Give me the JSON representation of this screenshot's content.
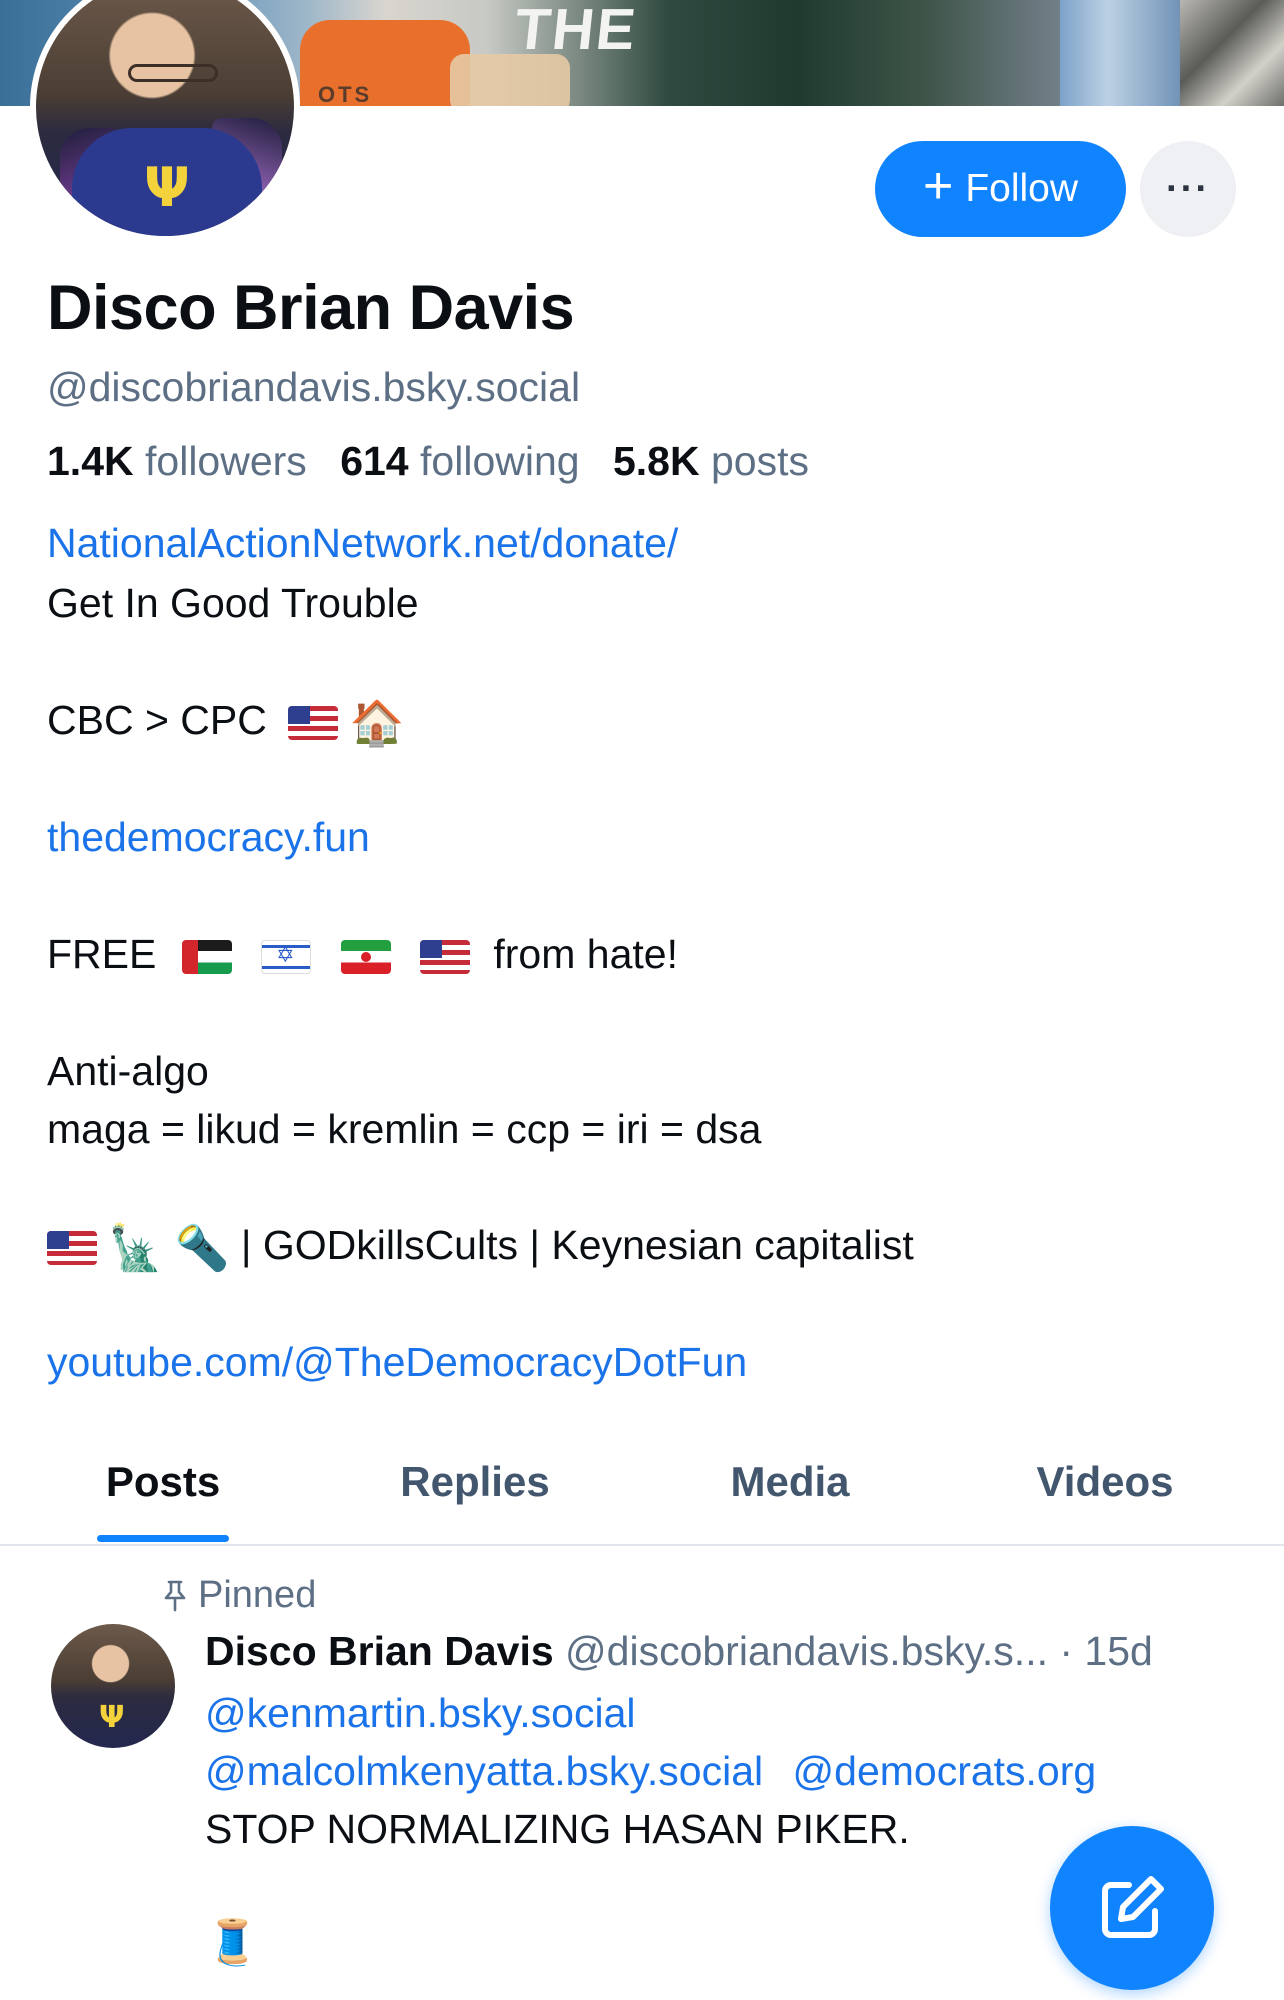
{
  "profile": {
    "name": "Disco Brian Davis",
    "handle": "@discobriandavis.bsky.social",
    "follow_label": "Follow",
    "more_label": "···",
    "stats": {
      "followers_count": "1.4K",
      "followers_label": "followers",
      "following_count": "614",
      "following_label": "following",
      "posts_count": "5.8K",
      "posts_label": "posts"
    }
  },
  "bio": {
    "link1": "NationalActionNetwork.net/donate/",
    "line1": "Get In Good Trouble",
    "line2": "CBC > CPC",
    "link2": "thedemocracy.fun",
    "free_text": "FREE",
    "from_hate": "from hate!",
    "line4": "Anti-algo",
    "line5": "maga = likud = kremlin = ccp = iri = dsa",
    "line6_rest": "| GODkillsCults | Keynesian capitalist",
    "link3": "youtube.com/@TheDemocracyDotFun"
  },
  "tabs": [
    {
      "label": "Posts",
      "active": true
    },
    {
      "label": "Replies",
      "active": false
    },
    {
      "label": "Media",
      "active": false
    },
    {
      "label": "Videos",
      "active": false
    }
  ],
  "post": {
    "pinned_label": "Pinned",
    "author": "Disco Brian Davis",
    "handle": "@discobriandavis.bsky.s...",
    "time": "· 15d",
    "mention1": "@kenmartin.bsky.social",
    "mention2": "@malcolmkenyatta.bsky.social",
    "mention3": "@democrats.org",
    "text": "STOP NORMALIZING HASAN PIKER.",
    "emoji": "🧵"
  },
  "banner": {
    "shirt_text": "THE",
    "cup_text": "OTS"
  },
  "colors": {
    "accent": "#1083fe",
    "link": "#1a73e8",
    "muted": "#5d6f84"
  },
  "icons": [
    "plus-icon",
    "more-icon",
    "pin-icon",
    "compose-icon"
  ]
}
